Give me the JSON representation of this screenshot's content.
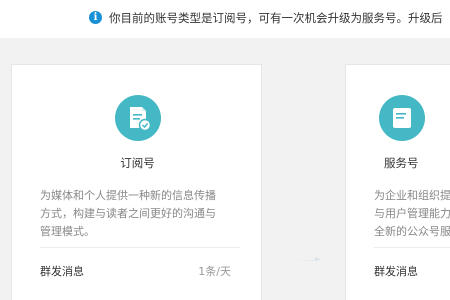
{
  "notice": {
    "icon": "info-icon",
    "text": "你目前的账号类型是订阅号，可有一次机会升级为服务号。升级后"
  },
  "cards": [
    {
      "icon": "document-check-icon",
      "title": "订阅号",
      "description_lines": [
        "为媒体和个人提供一种新的信息传播",
        "方式，构建与读者之间更好的沟通与",
        "管理模式。"
      ],
      "row_label": "群发消息",
      "row_value": "1条/天"
    },
    {
      "icon": "service-icon",
      "title": "服务号",
      "description_lines": [
        "为企业和组织提",
        "与用户管理能力",
        "全新的公众号服"
      ],
      "row_label": "群发消息"
    }
  ],
  "colors": {
    "accent_blue": "#1890d6",
    "badge_teal": "#44b8c4",
    "page_bg": "#f2f2f2"
  }
}
